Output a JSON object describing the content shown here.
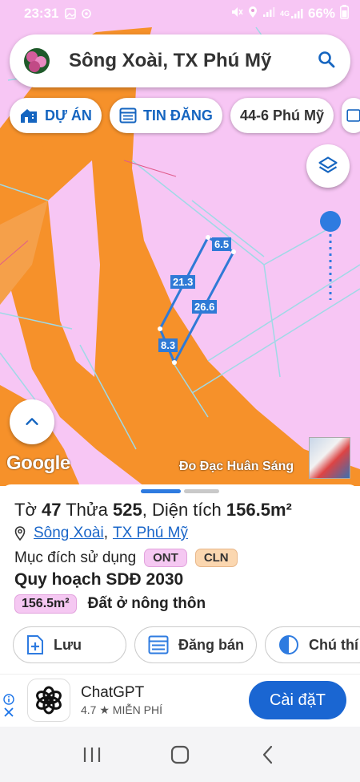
{
  "status_bar": {
    "time": "23:31",
    "network": "4G",
    "battery": "66%",
    "left_icons": [
      "image-icon",
      "sync-icon"
    ],
    "right_icons": [
      "mute-icon",
      "location-icon",
      "signal-icon",
      "signal-4g-icon",
      "battery-icon"
    ]
  },
  "search": {
    "query": "Sông Xoài, TX Phú Mỹ",
    "avatar_icon": "avatar-icon",
    "search_icon": "search-icon"
  },
  "chips": [
    {
      "label": "DỰ ÁN",
      "icon": "house-icon"
    },
    {
      "label": "TIN ĐĂNG",
      "icon": "list-icon"
    },
    {
      "label": "44-6 Phú Mỹ",
      "icon": ""
    }
  ],
  "map": {
    "edge_labels": [
      "6.5",
      "21.3",
      "26.6",
      "8.3"
    ],
    "brand": "Google",
    "attribution": "Đo Đạc Huân Sáng",
    "colors": {
      "ont": "#f7c6f4",
      "cln": "#f6912a",
      "parcel_line": "#2f7ad6",
      "boundary": "#9fd9e6"
    }
  },
  "sheet": {
    "sheet_label": "Tờ",
    "sheet_no": "47",
    "plot_label": "Thửa",
    "plot_no": "525",
    "area_label": "Diện tích",
    "area_value": "156.5m²",
    "ward": "Sông Xoài",
    "town": "TX Phú Mỹ",
    "separator": ",",
    "purpose_label": "Mục đích sử dụng",
    "tags": [
      "ONT",
      "CLN"
    ],
    "plan_title": "Quy hoạch SDĐ 2030",
    "plan_area": "156.5m²",
    "plan_land_type": "Đất ở nông thôn"
  },
  "actions": [
    {
      "label": "Lưu",
      "icon": "save-plus-icon"
    },
    {
      "label": "Đăng bán",
      "icon": "list-icon"
    },
    {
      "label": "Chú thí",
      "icon": "legend-icon"
    }
  ],
  "ad": {
    "app_name": "ChatGPT",
    "rating": "4.7 ★  MIỄN PHÍ",
    "install_label": "Cài đặT"
  },
  "nav": [
    "recents-icon",
    "home-icon",
    "back-icon"
  ]
}
